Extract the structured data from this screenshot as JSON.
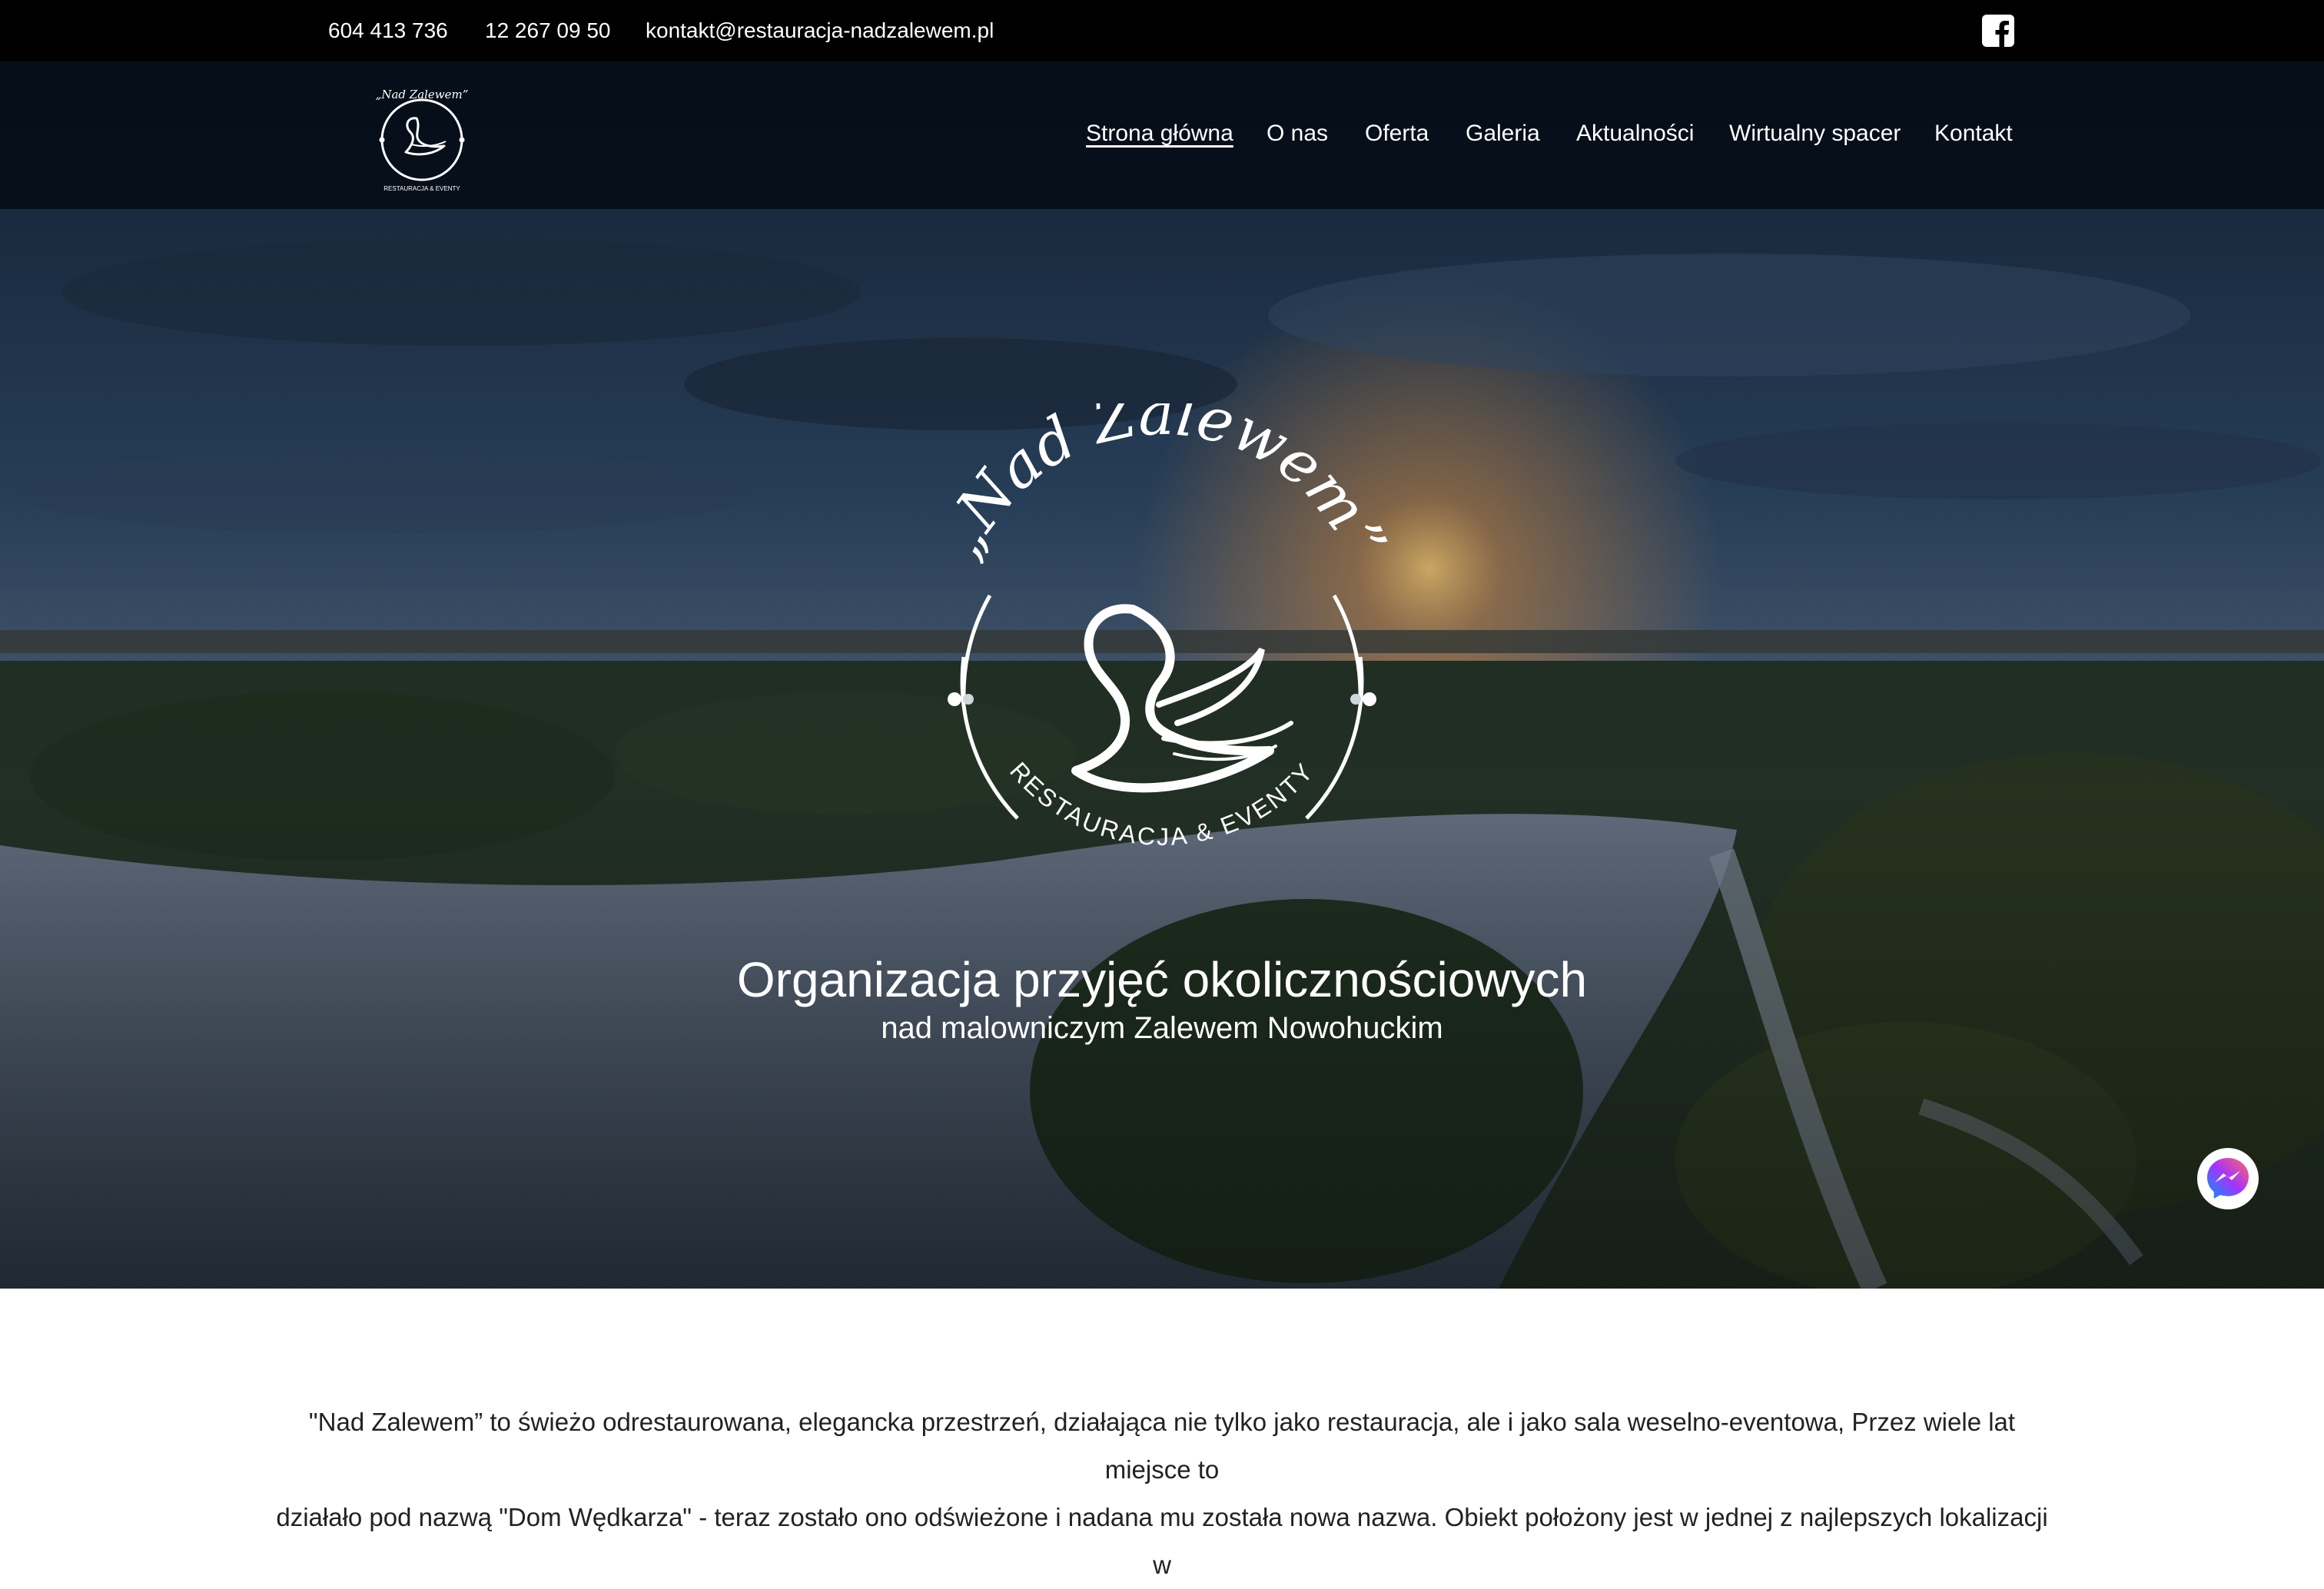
{
  "topbar": {
    "phone_1": "604 413 736",
    "phone_2": "12 267 09 50",
    "email": "kontakt@restauracja-nadzalewem.pl",
    "social_icon": "facebook-square-icon"
  },
  "logo": {
    "script_text": "„Nad Zalewem”",
    "tagline": "RESTAURACJA & EVENTY"
  },
  "nav": {
    "items": [
      {
        "label": "Strona główna",
        "active": true
      },
      {
        "label": "O nas"
      },
      {
        "label": "Oferta"
      },
      {
        "label": "Galeria"
      },
      {
        "label": "Aktualności"
      },
      {
        "label": "Wirtualny spacer"
      },
      {
        "label": "Kontakt"
      }
    ]
  },
  "hero": {
    "title": "Organizacja przyjęć okolicznościowych",
    "subtitle": "nad malowniczym Zalewem Nowohuckim"
  },
  "messenger": {
    "icon": "messenger-icon"
  },
  "intro": {
    "line_1": "\"Nad Zalewem” to świeżo odrestaurowana, elegancka przestrzeń, działająca nie tylko jako restauracja, ale i jako sala weselno-eventowa, Przez wiele lat miejsce to",
    "line_2": "działało pod nazwą \"Dom Wędkarza\" - teraz zostało ono odświeżone i nadana mu została nowa nazwa. Obiekt położony jest w jednej z najlepszych lokalizacji w"
  },
  "colors": {
    "topbar_bg": "#000000",
    "nav_bg": "#050c16",
    "text_light": "#ffffff",
    "body_text": "#222222",
    "messenger_gradient": [
      "#a334fa",
      "#0695ff"
    ]
  }
}
